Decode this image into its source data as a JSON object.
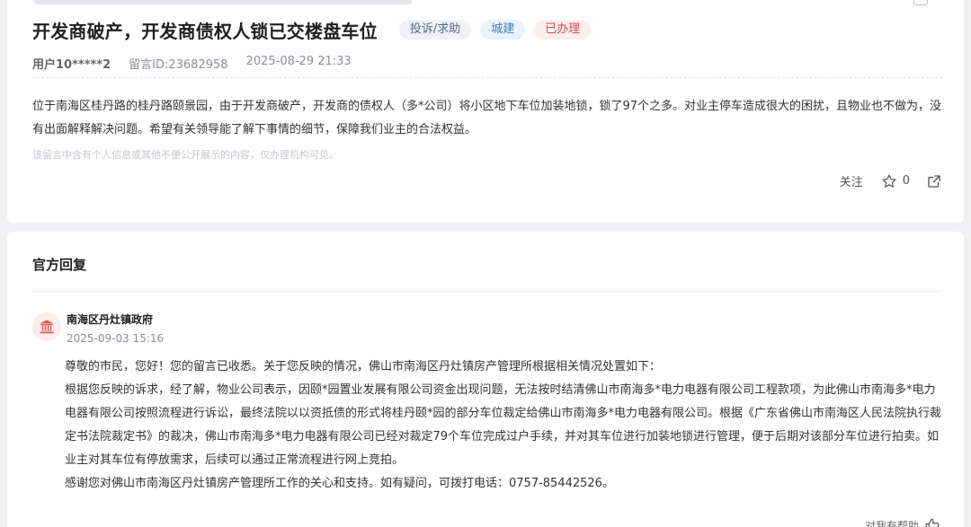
{
  "question": {
    "title": "开发商破产，开发商债权人锁已交楼盘车位",
    "tags": {
      "type": "投诉/求助",
      "category": "城建",
      "status": "已办理"
    },
    "tag_colors": {
      "type_text": "#5b6b85",
      "category_text": "#3d7cc9",
      "status_text": "#d84a4a"
    },
    "meta": {
      "user": "用户10*****2",
      "message_id": "留言ID:23682958",
      "datetime": "2025-08-29 21:33"
    },
    "content": "位于南海区桂丹路的桂丹路颐景园，由于开发商破产，开发商的债权人（多*公司）将小区地下车位加装地锁，锁了97个之多。对业主停车造成很大的困扰，且物业也不做为，没有出面解释解决问题。希望有关领导能了解下事情的细节，保障我们业主的合法权益。",
    "privacy_note": "该留言中含有个人信息或其他不便公开展示的内容，仅办理机构可见。",
    "actions": {
      "follow_label": "关注",
      "star_count": "0",
      "star_icon": "star-outline-icon",
      "share_icon": "share-icon"
    }
  },
  "reply": {
    "section_title": "官方回复",
    "org": {
      "icon": "government-building-icon",
      "name": "南海区丹灶镇政府",
      "datetime": "2025-09-03 15:16"
    },
    "paragraphs": [
      "尊敬的市民，您好！您的留言已收悉。关于您反映的情况，佛山市南海区丹灶镇房产管理所根据相关情况处置如下：",
      "根据您反映的诉求，经了解，物业公司表示，因颐*园置业发展有限公司资金出现问题，无法按时结清佛山市南海多*电力电器有限公司工程款项，为此佛山市南海多*电力电器有限公司按照流程进行诉讼，最终法院以以资抵债的形式将桂丹颐*园的部分车位裁定给佛山市南海多*电力电器有限公司。根据《广东省佛山市南海区人民法院执行裁定书法院裁定书》的裁决，佛山市南海多*电力电器有限公司已经对裁定79个车位完成过户手续，并对其车位进行加装地锁进行管理，便于后期对该部分车位进行拍卖。如业主对其车位有停放需求，后续可以通过正常流程进行网上竞拍。",
      "感谢您对佛山市南海区丹灶镇房产管理所工作的关心和支持。如有疑问，可拨打电话：0757-85442526。"
    ],
    "helpful_label": "对我有帮助",
    "helpful_icon": "thumbs-up-icon"
  }
}
